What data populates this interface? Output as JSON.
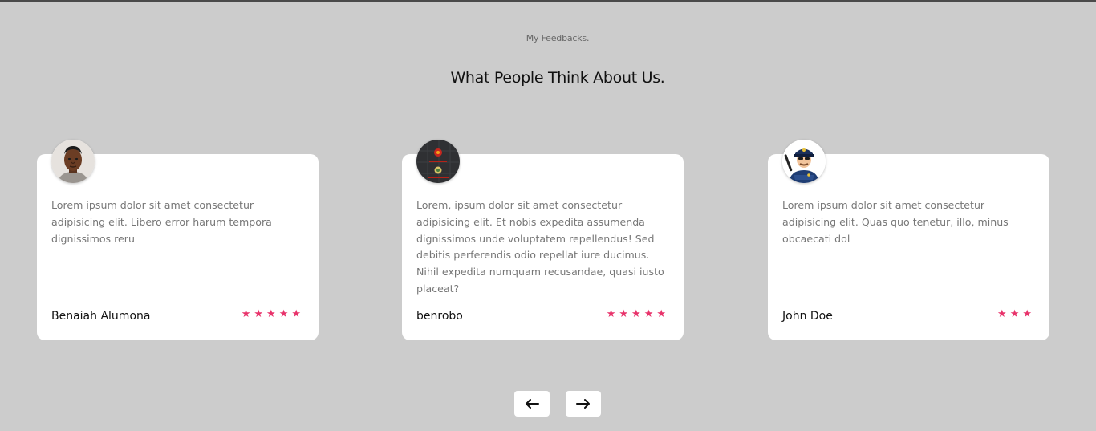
{
  "section": {
    "eyebrow": "My Feedbacks.",
    "heading": "What People Think About Us."
  },
  "testimonials": [
    {
      "avatar_icon": "man-portrait-icon",
      "text": "Lorem ipsum dolor sit amet consectetur adipisicing elit. Libero error harum tempora dignissimos reru",
      "author": "Benaiah Alumona",
      "rating": 5
    },
    {
      "avatar_icon": "robot-avatar-icon",
      "text": "Lorem, ipsum dolor sit amet consectetur adipisicing elit. Et nobis expedita assumenda dignissimos unde voluptatem repellendus! Sed debitis perferendis odio repellat iure ducimus. Nihil expedita numquam recusandae, quasi iusto placeat?",
      "author": "benrobo",
      "rating": 5
    },
    {
      "avatar_icon": "police-officer-icon",
      "text": "Lorem ipsum dolor sit amet consectetur adipisicing elit. Quas quo tenetur, illo, minus obcaecati dol",
      "author": "John Doe",
      "rating": 3
    }
  ],
  "navigation": {
    "prev_icon": "arrow-left-icon",
    "next_icon": "arrow-right-icon"
  },
  "colors": {
    "background": "#cccccc",
    "card": "#ffffff",
    "star": "#e8336b",
    "text_muted": "#777777",
    "text_dark": "#111111"
  }
}
